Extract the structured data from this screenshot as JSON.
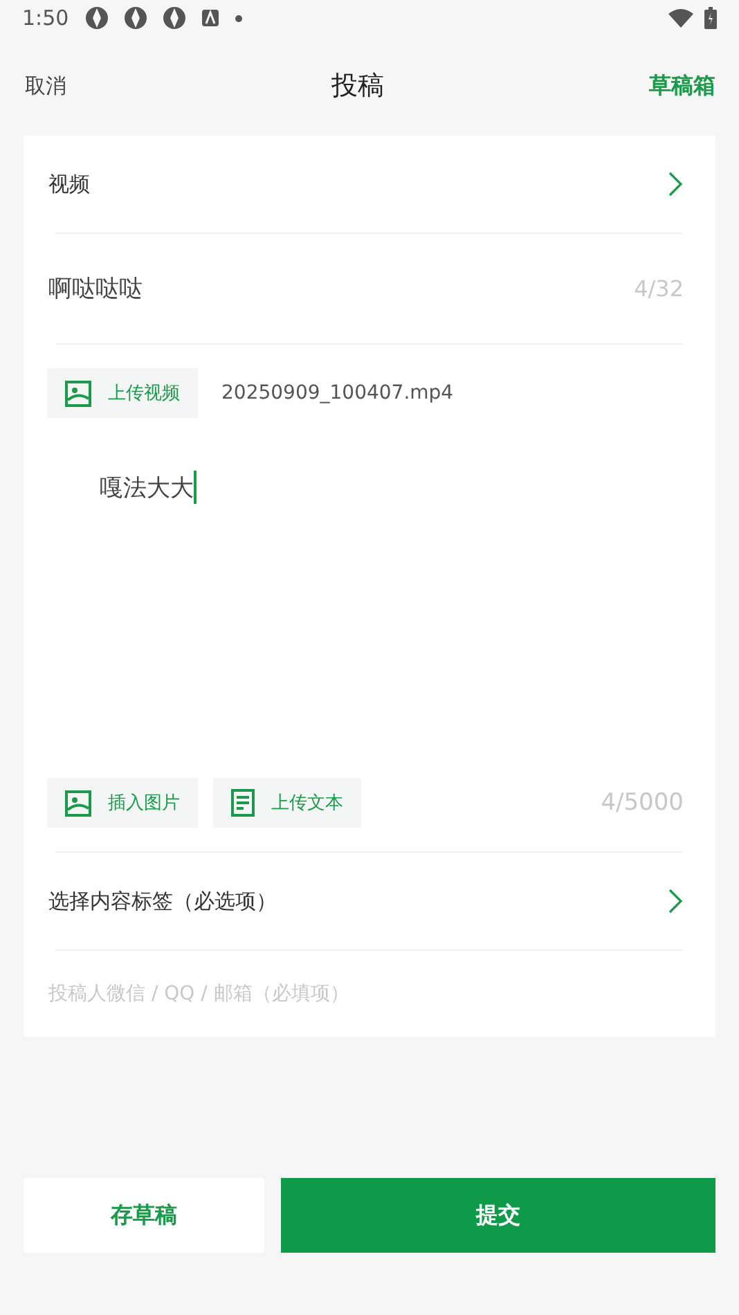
{
  "status_bar": {
    "time": "1:50"
  },
  "header": {
    "cancel": "取消",
    "title": "投稿",
    "drafts": "草稿箱"
  },
  "form": {
    "category": {
      "label": "视频"
    },
    "title_field": {
      "value": "啊哒哒哒",
      "counter": "4/32"
    },
    "upload": {
      "button": "上传视频",
      "file_name": "20250909_100407.mp4"
    },
    "body": {
      "value": "嘎法大大",
      "counter": "4/5000"
    },
    "tools": [
      {
        "kind": "image",
        "label": "插入图片"
      },
      {
        "kind": "document",
        "label": "上传文本"
      }
    ],
    "tags": {
      "label": "选择内容标签（必选项）"
    },
    "contact": {
      "placeholder": "投稿人微信 / QQ / 邮箱（必填项）"
    }
  },
  "actions": {
    "save": "存草稿",
    "submit": "提交"
  }
}
